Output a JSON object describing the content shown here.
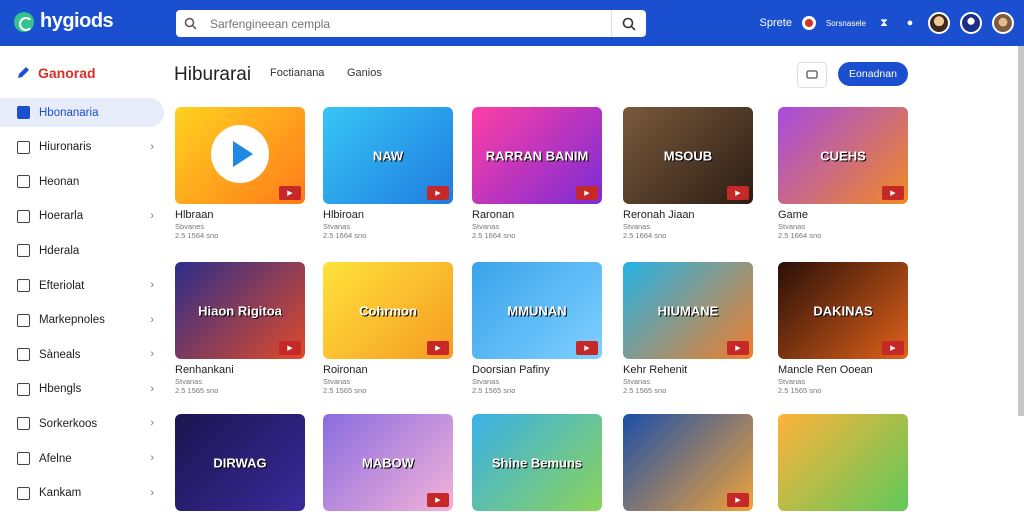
{
  "header": {
    "logo": "hygiods",
    "search_placeholder": "Sarfengineean cempla",
    "right_text": "Sprete",
    "small_text": "Sorsnasele"
  },
  "sidebar": {
    "title": "Ganorad",
    "items": [
      {
        "label": "Hbonanaria",
        "active": true,
        "chevron": false
      },
      {
        "label": "Hiuronaris",
        "active": false,
        "chevron": true
      },
      {
        "label": "Heonan",
        "active": false,
        "chevron": false
      },
      {
        "label": "Hoerarla",
        "active": false,
        "chevron": true
      },
      {
        "label": "Hderala",
        "active": false,
        "chevron": false
      },
      {
        "label": "Efteriolat",
        "active": false,
        "chevron": true
      },
      {
        "label": "Markepnoles",
        "active": false,
        "chevron": true
      },
      {
        "label": "Sàneals",
        "active": false,
        "chevron": true
      },
      {
        "label": "Hbengls",
        "active": false,
        "chevron": true
      },
      {
        "label": "Sorkerkoos",
        "active": false,
        "chevron": true
      },
      {
        "label": "Afelne",
        "active": false,
        "chevron": true
      },
      {
        "label": "Kankam",
        "active": false,
        "chevron": true
      }
    ]
  },
  "main": {
    "title": "Hiburarai",
    "tabs": [
      "Foctianana",
      "Ganios"
    ],
    "primary_button": "Eonadnan"
  },
  "cards": [
    {
      "title": "Hlbraan",
      "sub": "Sbvanes",
      "meta": "2.5 1564 sno",
      "art": "",
      "colors": [
        "#ffd21f",
        "#ff7a1a"
      ]
    },
    {
      "title": "Hlbiroan",
      "sub": "Stvanas",
      "meta": "2.5 1664 sno",
      "art": "NAW",
      "colors": [
        "#38c6f5",
        "#1e7be0"
      ]
    },
    {
      "title": "Raronan",
      "sub": "Stvanas",
      "meta": "2.5 1664 sno",
      "art": "RARRAN BANIM",
      "colors": [
        "#ff3fa4",
        "#7a2bd6"
      ]
    },
    {
      "title": "Reronah Jiaan",
      "sub": "Stvanas",
      "meta": "2.5 1664 sno",
      "art": "MSOUB",
      "colors": [
        "#7a5a3c",
        "#2b1d14"
      ]
    },
    {
      "title": "Game",
      "sub": "Stvanas",
      "meta": "2.5 1664 sno",
      "art": "CUEHS",
      "colors": [
        "#a64be0",
        "#f08a24"
      ]
    },
    {
      "title": "Renhankani",
      "sub": "Stvanas",
      "meta": "2.5 1565 sno",
      "art": "Hiaon Rigitoa",
      "colors": [
        "#2b2e8a",
        "#e04a2a"
      ]
    },
    {
      "title": "Roironan",
      "sub": "Stvanas",
      "meta": "2.5 1565 sno",
      "art": "Cohrmon",
      "colors": [
        "#ffe23a",
        "#f59b23"
      ]
    },
    {
      "title": "Doorsian Pafiny",
      "sub": "Stvanas",
      "meta": "2.5 1565 sno",
      "art": "MMUNAN",
      "colors": [
        "#3aa3ea",
        "#7ed0ff"
      ]
    },
    {
      "title": "Kehr Rehenit",
      "sub": "Stvanas",
      "meta": "2.5 1565 sno",
      "art": "HIUMANE",
      "colors": [
        "#23b3e6",
        "#f07d2a"
      ]
    },
    {
      "title": "Mancle Ren Ooean",
      "sub": "Stvanas",
      "meta": "2.5 1565 sno",
      "art": "DAKINAS",
      "colors": [
        "#2a0f08",
        "#e0621a"
      ]
    },
    {
      "title": "",
      "sub": "",
      "meta": "",
      "art": "DIRWAG",
      "colors": [
        "#1a1550",
        "#3b2a9a"
      ]
    },
    {
      "title": "",
      "sub": "",
      "meta": "",
      "art": "MABOW",
      "colors": [
        "#8a6ce0",
        "#f3b2d9"
      ]
    },
    {
      "title": "",
      "sub": "",
      "meta": "",
      "art": "Shine Bemuns",
      "colors": [
        "#3ab0e8",
        "#8bd35a"
      ]
    },
    {
      "title": "",
      "sub": "",
      "meta": "",
      "art": "",
      "colors": [
        "#1b4fa8",
        "#f0a23a"
      ]
    },
    {
      "title": "",
      "sub": "",
      "meta": "",
      "art": "",
      "colors": [
        "#ffb23a",
        "#5fc95a"
      ]
    }
  ],
  "colors": {
    "brand": "#1a4fd0",
    "accent_red": "#d93025",
    "active_bg": "#e6ecfa"
  }
}
